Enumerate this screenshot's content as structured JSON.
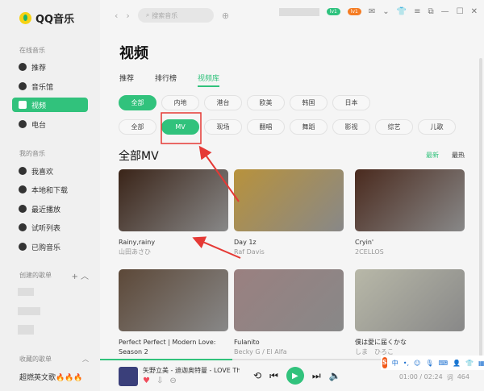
{
  "app": {
    "name": "QQ音乐"
  },
  "sidebar": {
    "online_label": "在线音乐",
    "online": [
      "推荐",
      "音乐馆",
      "视频",
      "电台"
    ],
    "my_label": "我的音乐",
    "my": [
      "我喜欢",
      "本地和下载",
      "最近播放",
      "试听列表",
      "已购音乐"
    ],
    "created_label": "创建的歌单",
    "collected_label": "收藏的歌单",
    "collected": [
      "超燃英文歌🔥🔥🔥"
    ]
  },
  "topbar": {
    "search_placeholder": "搜索音乐",
    "badge1": "lv1",
    "badge2": "lv1"
  },
  "page": {
    "title": "视频",
    "tabs": [
      "推荐",
      "排行榜",
      "视频库"
    ],
    "active_tab": 2
  },
  "filters": {
    "region": [
      "全部",
      "内地",
      "港台",
      "欧美",
      "韩国",
      "日本"
    ],
    "type": [
      "全部",
      "MV",
      "现场",
      "翻唱",
      "舞蹈",
      "影视",
      "综艺",
      "儿歌"
    ]
  },
  "section": {
    "title": "全部MV",
    "sort": [
      "最新",
      "最热"
    ]
  },
  "videos": [
    {
      "title": "Rainy,rainy",
      "artist": "山田あさひ",
      "color": "#3a2418"
    },
    {
      "title": "Day 1z",
      "artist": "Raf Davis",
      "color": "#b8923c"
    },
    {
      "title": "Cryin'",
      "artist": "2CELLOS",
      "color": "#4a2a1e"
    },
    {
      "title": "Perfect Perfect | Modern Love: Season 2",
      "artist": "",
      "color": "#5c4838"
    },
    {
      "title": "Fulanito",
      "artist": "Becky G / El Alfa",
      "color": "#9a8080"
    },
    {
      "title": "僕は愛に届くかな",
      "artist": "しま　ひろこ",
      "color": "#b8b8a8"
    }
  ],
  "player": {
    "track": "矢野立美 - 迪迦奥特曼 - LOVE Ther",
    "time": "01:00 / 02:24",
    "lyrics": "词",
    "count": "464",
    "progress": 0.42
  },
  "ime": {
    "lang": "中"
  },
  "colors": {
    "accent": "#31c27c",
    "annotation": "#e53935"
  }
}
